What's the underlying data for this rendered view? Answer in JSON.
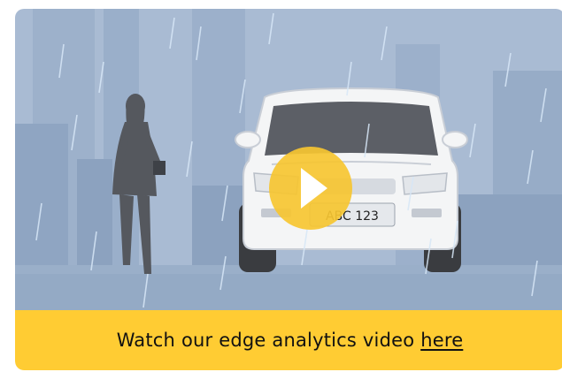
{
  "video": {
    "plate_text": "ABC 123",
    "play_icon": "play-icon"
  },
  "caption": {
    "text": "Watch our edge analytics video",
    "link_text": "here"
  },
  "colors": {
    "accent": "#FFCC33",
    "sky": "#A9BBD3",
    "play_button": "#F6C531"
  }
}
